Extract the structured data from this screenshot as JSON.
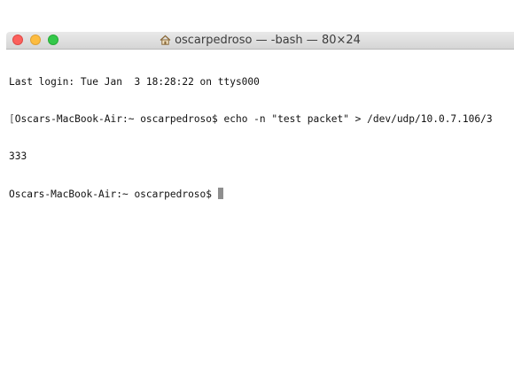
{
  "window": {
    "title": "oscarpedroso — -bash — 80×24",
    "title_icon": "home-icon"
  },
  "terminal": {
    "lines": [
      "Last login: Tue Jan  3 18:28:22 on ttys000",
      "Oscars-MacBook-Air:~ oscarpedroso$ echo -n \"test packet\" > /dev/udp/10.0.7.106/3",
      "333",
      "Oscars-MacBook-Air:~ oscarpedroso$ "
    ],
    "cursor": "block-cursor"
  }
}
